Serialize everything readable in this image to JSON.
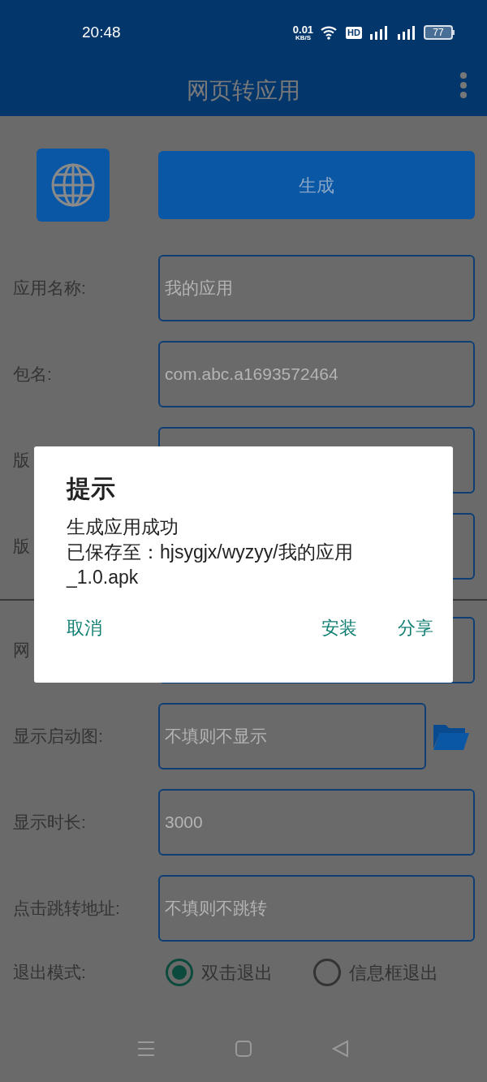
{
  "status_bar": {
    "time": "20:48",
    "net_speed": "0.01",
    "net_unit": "KB/S",
    "hd": "HD",
    "battery": "77"
  },
  "app_bar": {
    "title": "网页转应用"
  },
  "generate_button": "生成",
  "fields": [
    {
      "label": "应用名称:",
      "value": "我的应用"
    },
    {
      "label": "包名:",
      "value": "com.abc.a1693572464"
    },
    {
      "label": "版"
    },
    {
      "label": "版"
    },
    {
      "label": "网",
      "divider_before": true
    },
    {
      "label": "显示启动图:",
      "placeholder": "不填则不显示",
      "folder": true
    },
    {
      "label": "显示时长:",
      "placeholder": "3000"
    },
    {
      "label": "点击跳转地址:",
      "placeholder": "不填则不跳转"
    }
  ],
  "exit_mode": {
    "label": "退出模式:",
    "options": [
      {
        "label": "双击退出",
        "selected": true
      },
      {
        "label": "信息框退出",
        "selected": false
      }
    ]
  },
  "dialog": {
    "title": "提示",
    "message": [
      "生成应用成功",
      "已保存至：hjsygjx/wyzyy/我的应用",
      "_1.0.apk"
    ],
    "left_buttons": [
      "取消"
    ],
    "right_buttons": [
      "安装",
      "分享"
    ]
  }
}
